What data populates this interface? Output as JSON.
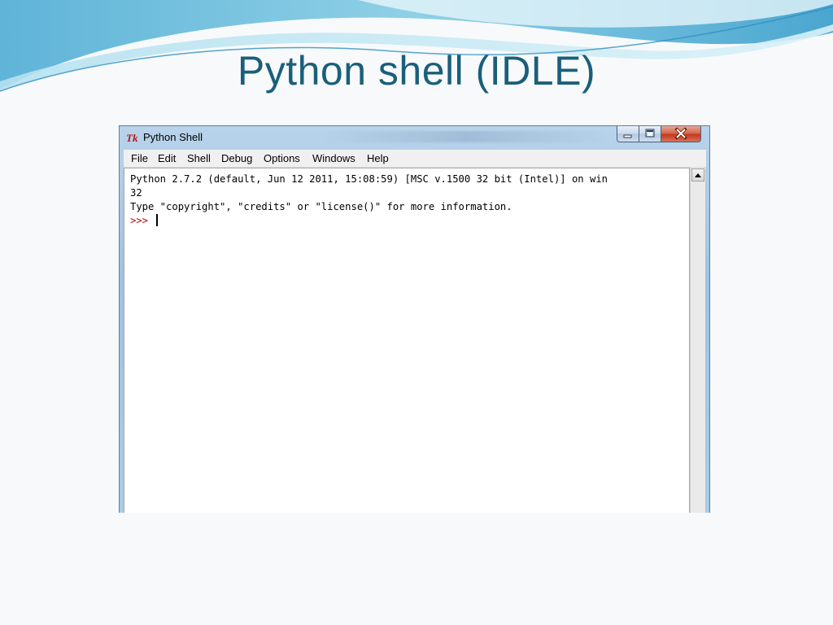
{
  "slide": {
    "title": "Python shell (IDLE)"
  },
  "window": {
    "title": "Python Shell",
    "icon": "tk-feather-icon",
    "controls": [
      "minimize-icon",
      "maximize-icon",
      "close-icon"
    ]
  },
  "menu": {
    "items": [
      "File",
      "Edit",
      "Shell",
      "Debug",
      "Options",
      "Windows",
      "Help"
    ]
  },
  "shell": {
    "lines": [
      "Python 2.7.2 (default, Jun 12 2011, 15:08:59) [MSC v.1500 32 bit (Intel)] on win",
      "32",
      "Type \"copyright\", \"credits\" or \"license()\" for more information."
    ],
    "prompt": ">>> "
  },
  "colors": {
    "title": "#1a5f7a",
    "prompt": "#c00000",
    "close_button": "#c4391a"
  }
}
